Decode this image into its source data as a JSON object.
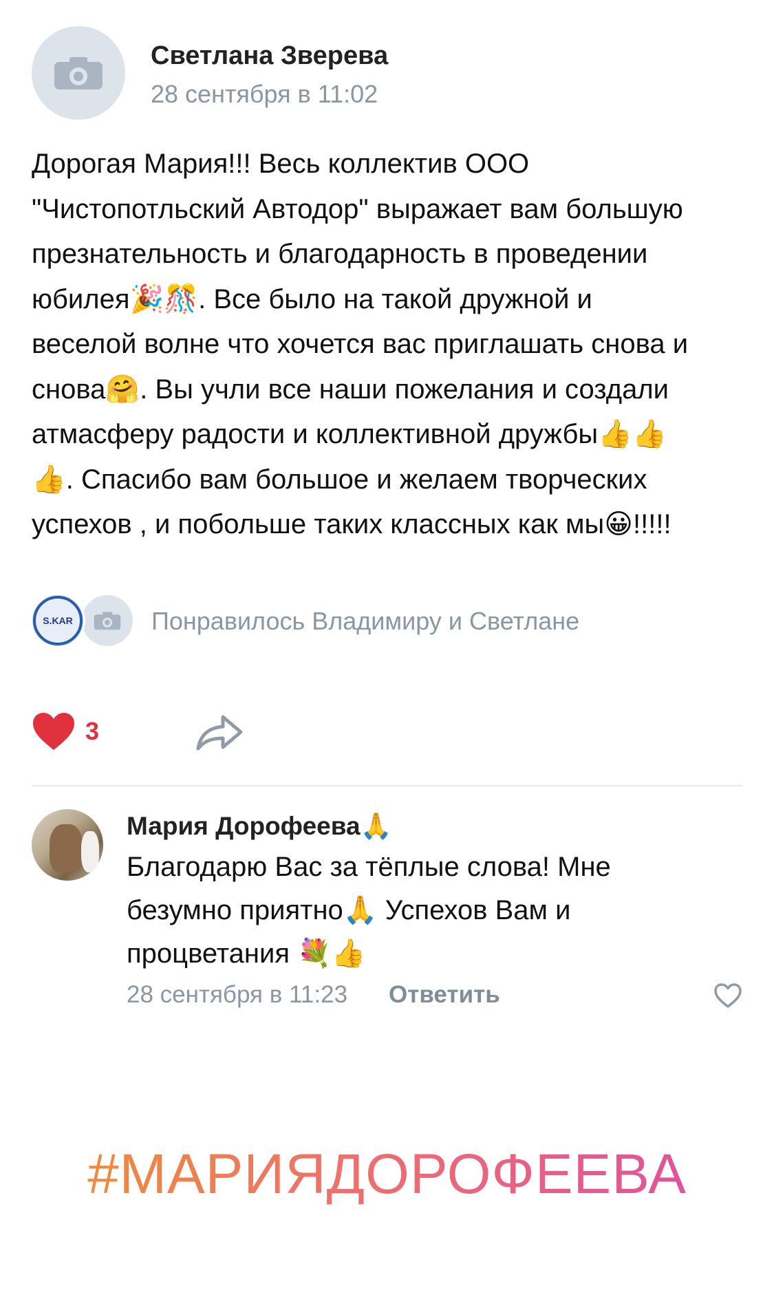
{
  "post": {
    "author": "Светлана Зверева",
    "date": "28 сентября в 11:02",
    "text_lines": [
      "Дорогая Мария!!! Весь коллектив ООО",
      "\"Чистопотльский Автодор\" выражает вам большую",
      "презнательность и благодарность в проведении",
      "юбилея🎉🎊. Все было на такой дружной и",
      "веселой волне что хочется вас приглашать снова и",
      "снова🤗. Вы учли все наши пожелания и создали",
      "атмасферу радости и коллективной дружбы👍👍",
      "👍. Спасибо вам большое и желаем творческих",
      "успехов , и побольше таких классных как мы😀!!!!!"
    ]
  },
  "likes": {
    "avatar_1_label": "S.KAR",
    "text": "Понравилось Владимиру и Светлане"
  },
  "actions": {
    "like_count": "3",
    "colors": {
      "like": "#e0313f",
      "muted": "#8a96a3",
      "icon": "#8f9ba8"
    }
  },
  "comment": {
    "author": "Мария Дорофеева🙏",
    "text_lines": [
      "Благодарю Вас за тёплые слова! Мне",
      "безумно приятно🙏 Успехов Вам и",
      "процветания 💐👍"
    ],
    "date": "28 сентября в 11:23",
    "reply_label": "Ответить"
  },
  "hashtag": "#МАРИЯДОРОФЕЕВА",
  "icons": [
    "camera-icon",
    "heart-icon",
    "share-icon",
    "comment-like-icon"
  ]
}
